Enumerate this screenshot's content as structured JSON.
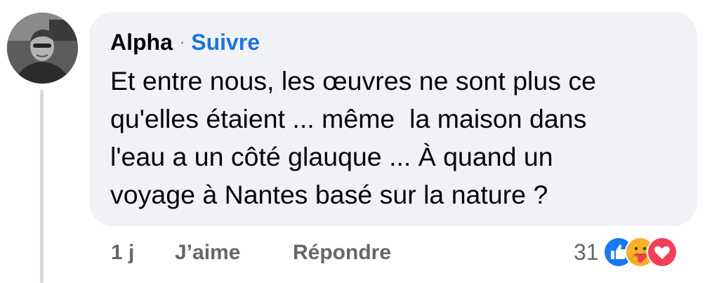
{
  "comment": {
    "author": "Alpha",
    "separator": "·",
    "follow_label": "Suivre",
    "text_lines": [
      "Et entre nous, les œuvres ne sont plus ce",
      "qu'elles étaient ... même  la maison dans",
      "l'eau a un côté glauque ... À quand un",
      "voyage à Nantes basé sur la nature ?"
    ]
  },
  "actions": {
    "time": "1 j",
    "like_label": "J’aime",
    "reply_label": "Répondre"
  },
  "reactions": {
    "count": "31",
    "icons": [
      "like-reaction-icon",
      "care-reaction-icon",
      "love-reaction-icon"
    ],
    "colors": {
      "like": "#1877f2",
      "care": "#f7b125",
      "love": "#f33e58"
    }
  },
  "colors": {
    "bubble": "#f0f2f5",
    "link": "#1b74e4",
    "secondary_text": "#65676b",
    "primary_text": "#050505"
  }
}
